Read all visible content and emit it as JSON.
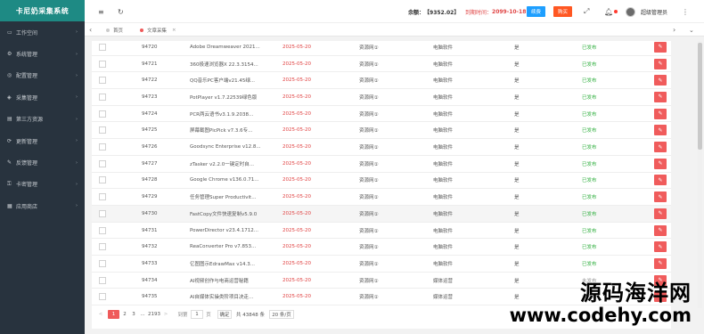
{
  "sidebar": {
    "brand": "卡尼奶采集系统",
    "items": [
      {
        "label": "工作空间",
        "icon": "workspace-icon"
      },
      {
        "label": "系统管理",
        "icon": "gear-icon"
      },
      {
        "label": "配置管理",
        "icon": "config-icon"
      },
      {
        "label": "采集管理",
        "icon": "shield-icon"
      },
      {
        "label": "第三方资源",
        "icon": "resource-icon"
      },
      {
        "label": "更新管理",
        "icon": "update-icon"
      },
      {
        "label": "反馈管理",
        "icon": "feedback-icon"
      },
      {
        "label": "卡密管理",
        "icon": "key-icon"
      },
      {
        "label": "应用商店",
        "icon": "store-icon"
      }
    ]
  },
  "topbar": {
    "menu_icon": "≡",
    "refresh_icon": "↻",
    "balance_label": "余额：",
    "balance_value": "【9352.02】",
    "expire_label": "到期时间：",
    "expire_value": "2099-10-18",
    "renew_label": "续费",
    "buy_label": "购买",
    "user_name": "超级管理员"
  },
  "tabs": {
    "home": "首页",
    "active": "文章采集"
  },
  "rows": [
    {
      "id": "94720",
      "title": "Adobe Dreamweaver 2021...",
      "date": "2025-05-20",
      "source": "资源网①",
      "category": "电脑软件",
      "flag": "是",
      "status": "已发布"
    },
    {
      "id": "94721",
      "title": "360极速浏览器X 22.3.3154...",
      "date": "2025-05-20",
      "source": "资源网①",
      "category": "电脑软件",
      "flag": "是",
      "status": "已发布"
    },
    {
      "id": "94722",
      "title": "QQ音乐PC客户端v21.45绿...",
      "date": "2025-05-20",
      "source": "资源网①",
      "category": "电脑软件",
      "flag": "是",
      "status": "已发布"
    },
    {
      "id": "94723",
      "title": "PotPlayer v1.7.22539绿色版",
      "date": "2025-05-20",
      "source": "资源网①",
      "category": "电脑软件",
      "flag": "是",
      "status": "已发布"
    },
    {
      "id": "94724",
      "title": "PCR两云语书v3.1.9.2038...",
      "date": "2025-05-20",
      "source": "资源网①",
      "category": "电脑软件",
      "flag": "是",
      "status": "已发布"
    },
    {
      "id": "94725",
      "title": "屏幕截图PicPick v7.3.6专...",
      "date": "2025-05-20",
      "source": "资源网①",
      "category": "电脑软件",
      "flag": "是",
      "status": "已发布"
    },
    {
      "id": "94726",
      "title": "Goodsync Enterprise v12.8...",
      "date": "2025-05-20",
      "source": "资源网①",
      "category": "电脑软件",
      "flag": "是",
      "status": "已发布"
    },
    {
      "id": "94727",
      "title": "zTasker v2.2.0一键定时自...",
      "date": "2025-05-20",
      "source": "资源网①",
      "category": "电脑软件",
      "flag": "是",
      "status": "已发布"
    },
    {
      "id": "94728",
      "title": "Google Chrome v136.0.71...",
      "date": "2025-05-20",
      "source": "资源网①",
      "category": "电脑软件",
      "flag": "是",
      "status": "已发布"
    },
    {
      "id": "94729",
      "title": "任务管理Super Productivit...",
      "date": "2025-05-20",
      "source": "资源网①",
      "category": "电脑软件",
      "flag": "是",
      "status": "已发布"
    },
    {
      "id": "94730",
      "title": "FastCopy文件快速复制v5.9.0",
      "date": "2025-05-20",
      "source": "资源网①",
      "category": "电脑软件",
      "flag": "是",
      "status": "已发布"
    },
    {
      "id": "94731",
      "title": "PowerDirector v23.4.1712...",
      "date": "2025-05-20",
      "source": "资源网①",
      "category": "电脑软件",
      "flag": "是",
      "status": "已发布"
    },
    {
      "id": "94732",
      "title": "ReaConverter Pro v7.853...",
      "date": "2025-05-20",
      "source": "资源网①",
      "category": "电脑软件",
      "flag": "是",
      "status": "已发布"
    },
    {
      "id": "94733",
      "title": "亿图图示EdrawMax v14.3...",
      "date": "2025-05-20",
      "source": "资源网①",
      "category": "电脑软件",
      "flag": "是",
      "status": "已发布"
    },
    {
      "id": "94734",
      "title": "AI视频创作与电商运营秘籍",
      "date": "2025-05-20",
      "source": "资源网①",
      "category": "媒体运营",
      "flag": "是",
      "status": "未发布"
    },
    {
      "id": "94735",
      "title": "AI自媒体实操类阶项目决走...",
      "date": "2025-05-20",
      "source": "资源网①",
      "category": "媒体运营",
      "flag": "是",
      "status": "未发布"
    }
  ],
  "pager": {
    "prev": "<",
    "pages": [
      "1",
      "2",
      "3",
      "...",
      "2193"
    ],
    "next": ">",
    "goto_label": "到第",
    "goto_value": "1",
    "page_unit": "页",
    "confirm": "确定",
    "total": "共 43848 条",
    "page_size": "20 条/页"
  },
  "watermark": {
    "cn": "源码海洋网",
    "url": "www.codehy.com"
  }
}
